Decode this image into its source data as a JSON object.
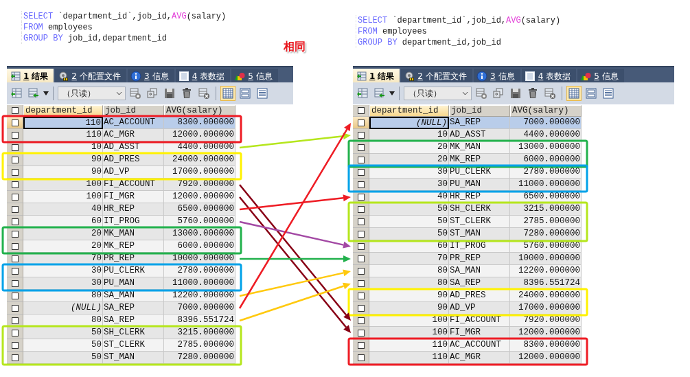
{
  "note": "相同",
  "panels": [
    {
      "sql": [
        [
          {
            "text": "SELECT",
            "kind": "keyword"
          },
          {
            "text": " `department_id`,job_id,",
            "kind": "plain"
          },
          {
            "text": "AVG",
            "kind": "function"
          },
          {
            "text": "(salary)",
            "kind": "plain"
          }
        ],
        [
          {
            "text": "FROM",
            "kind": "keyword"
          },
          {
            "text": " employees",
            "kind": "plain"
          }
        ],
        [
          {
            "text": "GROUP BY",
            "kind": "keyword"
          },
          {
            "text": " job_id,department_id",
            "kind": "plain"
          }
        ]
      ],
      "tabs": [
        {
          "number": "1",
          "label": "结果",
          "kind": "results",
          "selected": true
        },
        {
          "number": "2",
          "label": "个配置文件",
          "kind": "profiler",
          "selected": false
        },
        {
          "number": "3",
          "label": "信息",
          "kind": "messages",
          "selected": false
        },
        {
          "number": "4",
          "label": "表数据",
          "kind": "tabledata",
          "selected": false
        },
        {
          "number": "5",
          "label": "信息",
          "kind": "info",
          "selected": false
        }
      ],
      "mode": "（只读）",
      "view_buttons": [
        {
          "kind": "grid",
          "selected": true
        },
        {
          "kind": "form",
          "selected": false
        },
        {
          "kind": "text",
          "selected": false
        }
      ],
      "all_checked": false,
      "columns": [
        "department_id",
        "job_id",
        "AVG(salary)"
      ],
      "rows": [
        {
          "department_id": "110",
          "job_id": "AC_ACCOUNT",
          "avg": "8300.000000",
          "is_null": false,
          "checked": false,
          "selected": true
        },
        {
          "department_id": "110",
          "job_id": "AC_MGR",
          "avg": "12000.000000",
          "is_null": false,
          "checked": false,
          "selected": false
        },
        {
          "department_id": "10",
          "job_id": "AD_ASST",
          "avg": "4400.000000",
          "is_null": false,
          "checked": false,
          "selected": false
        },
        {
          "department_id": "90",
          "job_id": "AD_PRES",
          "avg": "24000.000000",
          "is_null": false,
          "checked": false,
          "selected": false
        },
        {
          "department_id": "90",
          "job_id": "AD_VP",
          "avg": "17000.000000",
          "is_null": false,
          "checked": false,
          "selected": false
        },
        {
          "department_id": "100",
          "job_id": "FI_ACCOUNT",
          "avg": "7920.000000",
          "is_null": false,
          "checked": false,
          "selected": false
        },
        {
          "department_id": "100",
          "job_id": "FI_MGR",
          "avg": "12000.000000",
          "is_null": false,
          "checked": false,
          "selected": false
        },
        {
          "department_id": "40",
          "job_id": "HR_REP",
          "avg": "6500.000000",
          "is_null": false,
          "checked": false,
          "selected": false
        },
        {
          "department_id": "60",
          "job_id": "IT_PROG",
          "avg": "5760.000000",
          "is_null": false,
          "checked": false,
          "selected": false
        },
        {
          "department_id": "20",
          "job_id": "MK_MAN",
          "avg": "13000.000000",
          "is_null": false,
          "checked": false,
          "selected": false
        },
        {
          "department_id": "20",
          "job_id": "MK_REP",
          "avg": "6000.000000",
          "is_null": false,
          "checked": false,
          "selected": false
        },
        {
          "department_id": "70",
          "job_id": "PR_REP",
          "avg": "10000.000000",
          "is_null": false,
          "checked": false,
          "selected": false
        },
        {
          "department_id": "30",
          "job_id": "PU_CLERK",
          "avg": "2780.000000",
          "is_null": false,
          "checked": false,
          "selected": false
        },
        {
          "department_id": "30",
          "job_id": "PU_MAN",
          "avg": "11000.000000",
          "is_null": false,
          "checked": false,
          "selected": false
        },
        {
          "department_id": "80",
          "job_id": "SA_MAN",
          "avg": "12200.000000",
          "is_null": false,
          "checked": false,
          "selected": false
        },
        {
          "department_id": "(NULL)",
          "job_id": "SA_REP",
          "avg": "7000.000000",
          "is_null": true,
          "checked": false,
          "selected": false
        },
        {
          "department_id": "80",
          "job_id": "SA_REP",
          "avg": "8396.551724",
          "is_null": false,
          "checked": false,
          "selected": false
        },
        {
          "department_id": "50",
          "job_id": "SH_CLERK",
          "avg": "3215.000000",
          "is_null": false,
          "checked": false,
          "selected": false
        },
        {
          "department_id": "50",
          "job_id": "ST_CLERK",
          "avg": "2785.000000",
          "is_null": false,
          "checked": false,
          "selected": false
        },
        {
          "department_id": "50",
          "job_id": "ST_MAN",
          "avg": "7280.000000",
          "is_null": false,
          "checked": false,
          "selected": false
        }
      ]
    },
    {
      "sql": [
        [
          {
            "text": "SELECT",
            "kind": "keyword"
          },
          {
            "text": " `department_id`,job_id,",
            "kind": "plain"
          },
          {
            "text": "AVG",
            "kind": "function"
          },
          {
            "text": "(salary)",
            "kind": "plain"
          }
        ],
        [
          {
            "text": "FROM",
            "kind": "keyword"
          },
          {
            "text": " employees",
            "kind": "plain"
          }
        ],
        [
          {
            "text": "GROUP BY",
            "kind": "keyword"
          },
          {
            "text": " department_id,job_id",
            "kind": "plain"
          }
        ]
      ],
      "tabs": [
        {
          "number": "1",
          "label": "结果",
          "kind": "results",
          "selected": true
        },
        {
          "number": "2",
          "label": "个配置文件",
          "kind": "profiler",
          "selected": false
        },
        {
          "number": "3",
          "label": "信息",
          "kind": "messages",
          "selected": false
        },
        {
          "number": "4",
          "label": "表数据",
          "kind": "tabledata",
          "selected": false
        },
        {
          "number": "5",
          "label": "信息",
          "kind": "info",
          "selected": false
        }
      ],
      "mode": "（只读）",
      "view_buttons": [
        {
          "kind": "grid",
          "selected": true
        },
        {
          "kind": "form",
          "selected": false
        },
        {
          "kind": "text",
          "selected": false
        }
      ],
      "all_checked": false,
      "columns": [
        "department_id",
        "job_id",
        "AVG(salary)"
      ],
      "rows": [
        {
          "department_id": "(NULL)",
          "job_id": "SA_REP",
          "avg": "7000.000000",
          "is_null": true,
          "checked": false,
          "selected": true
        },
        {
          "department_id": "10",
          "job_id": "AD_ASST",
          "avg": "4400.000000",
          "is_null": false,
          "checked": false,
          "selected": false
        },
        {
          "department_id": "20",
          "job_id": "MK_MAN",
          "avg": "13000.000000",
          "is_null": false,
          "checked": false,
          "selected": false
        },
        {
          "department_id": "20",
          "job_id": "MK_REP",
          "avg": "6000.000000",
          "is_null": false,
          "checked": false,
          "selected": false
        },
        {
          "department_id": "30",
          "job_id": "PU_CLERK",
          "avg": "2780.000000",
          "is_null": false,
          "checked": false,
          "selected": false
        },
        {
          "department_id": "30",
          "job_id": "PU_MAN",
          "avg": "11000.000000",
          "is_null": false,
          "checked": false,
          "selected": false
        },
        {
          "department_id": "40",
          "job_id": "HR_REP",
          "avg": "6500.000000",
          "is_null": false,
          "checked": false,
          "selected": false
        },
        {
          "department_id": "50",
          "job_id": "SH_CLERK",
          "avg": "3215.000000",
          "is_null": false,
          "checked": false,
          "selected": false
        },
        {
          "department_id": "50",
          "job_id": "ST_CLERK",
          "avg": "2785.000000",
          "is_null": false,
          "checked": false,
          "selected": false
        },
        {
          "department_id": "50",
          "job_id": "ST_MAN",
          "avg": "7280.000000",
          "is_null": false,
          "checked": false,
          "selected": false
        },
        {
          "department_id": "60",
          "job_id": "IT_PROG",
          "avg": "5760.000000",
          "is_null": false,
          "checked": false,
          "selected": false
        },
        {
          "department_id": "70",
          "job_id": "PR_REP",
          "avg": "10000.000000",
          "is_null": false,
          "checked": false,
          "selected": false
        },
        {
          "department_id": "80",
          "job_id": "SA_MAN",
          "avg": "12200.000000",
          "is_null": false,
          "checked": false,
          "selected": false
        },
        {
          "department_id": "80",
          "job_id": "SA_REP",
          "avg": "8396.551724",
          "is_null": false,
          "checked": false,
          "selected": false
        },
        {
          "department_id": "90",
          "job_id": "AD_PRES",
          "avg": "24000.000000",
          "is_null": false,
          "checked": false,
          "selected": false
        },
        {
          "department_id": "90",
          "job_id": "AD_VP",
          "avg": "17000.000000",
          "is_null": false,
          "checked": false,
          "selected": false
        },
        {
          "department_id": "100",
          "job_id": "FI_ACCOUNT",
          "avg": "7920.000000",
          "is_null": false,
          "checked": false,
          "selected": false
        },
        {
          "department_id": "100",
          "job_id": "FI_MGR",
          "avg": "12000.000000",
          "is_null": false,
          "checked": false,
          "selected": false
        },
        {
          "department_id": "110",
          "job_id": "AC_ACCOUNT",
          "avg": "8300.000000",
          "is_null": false,
          "checked": false,
          "selected": false
        },
        {
          "department_id": "110",
          "job_id": "AC_MGR",
          "avg": "12000.000000",
          "is_null": false,
          "checked": false,
          "selected": false
        }
      ]
    }
  ]
}
